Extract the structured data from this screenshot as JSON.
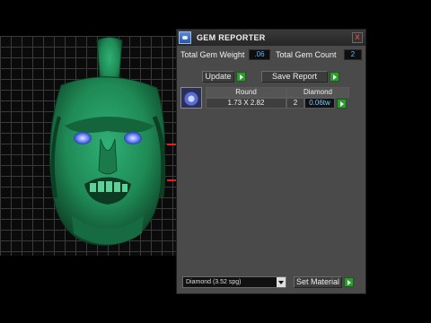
{
  "window": {
    "title": "GEM REPORTER",
    "close_glyph": "x"
  },
  "stats": {
    "total_gem_weight_label": "Total Gem Weight",
    "total_gem_weight_value": ".06",
    "total_gem_count_label": "Total Gem Count",
    "total_gem_count_value": "2"
  },
  "actions": {
    "update_label": "Update",
    "save_report_label": "Save Report"
  },
  "gem_table": {
    "shape": "Round",
    "material": "Diamond",
    "size": "1.73 X 2.82",
    "count": "2",
    "weight": "0.06tw"
  },
  "material_select": {
    "selected": "Diamond    (3.52 spg)",
    "set_material_label": "Set Material"
  },
  "colors": {
    "model_green": "#1f8a55",
    "gem_blue": "#6a86ff",
    "go_green": "#2f9a2f"
  },
  "icons": [
    "app-icon",
    "close-icon",
    "go-arrow-icon",
    "gem-thumbnail-icon",
    "dropdown-arrow-icon"
  ]
}
